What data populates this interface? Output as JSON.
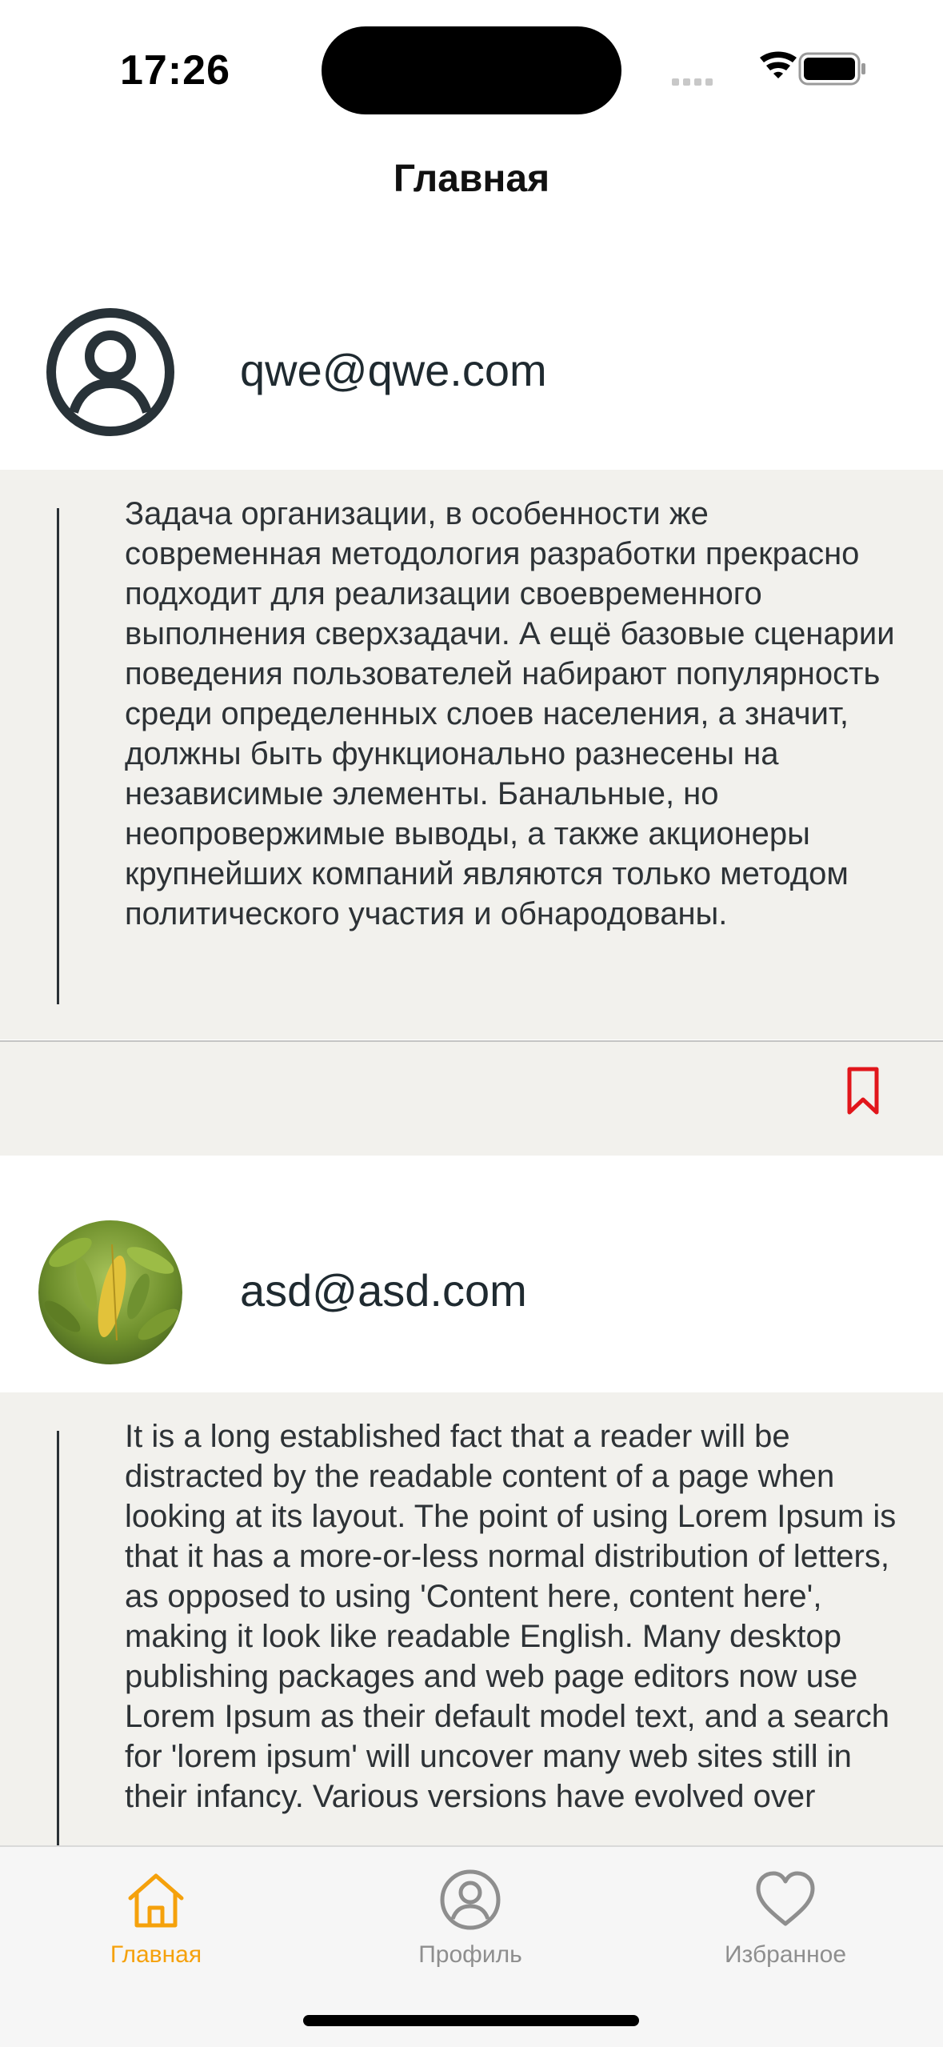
{
  "status_bar": {
    "time": "17:26"
  },
  "nav": {
    "title": "Главная"
  },
  "posts": [
    {
      "author_email": "qwe@qwe.com",
      "avatar": "person-circle-icon",
      "text": "Задача организации, в особенности же современная методология разработки прекрасно подходит для реализации своевременного выполнения сверхзадачи. А ещё базовые сценарии поведения пользователей набирают популярность среди определенных слоев населения, а значит, должны быть функционально разнесены на независимые элементы. Банальные, но неопровержимые выводы, а также акционеры крупнейших компаний являются только методом политического участия и обнародованы.",
      "bookmark_icon": "bookmark-icon"
    },
    {
      "author_email": "asd@asd.com",
      "avatar": "photo-avatar",
      "text": "It is a long established fact that a reader will be distracted by the readable content of a page when looking at its layout. The point of using Lorem Ipsum is that it has a more-or-less normal distribution of letters, as opposed to using 'Content here, content here', making it look like readable English. Many desktop publishing packages and web page editors now use Lorem Ipsum as their default model text, and a search for 'lorem ipsum' will uncover many web sites still in their infancy. Various versions have evolved over"
    }
  ],
  "tab_bar": {
    "items": [
      {
        "label": "Главная",
        "icon": "house-icon",
        "active": true
      },
      {
        "label": "Профиль",
        "icon": "person-circle-icon",
        "active": false
      },
      {
        "label": "Избранное",
        "icon": "heart-icon",
        "active": false
      }
    ]
  },
  "colors": {
    "accent": "#f5a10c",
    "bookmark": "#e1161b",
    "post_background": "#f2f1ed",
    "inactive_tab": "#8e8e8e"
  }
}
